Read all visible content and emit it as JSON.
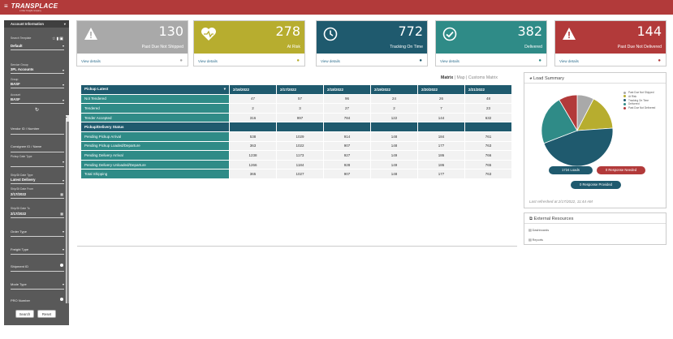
{
  "header": {
    "logo": "TRANSPLACE",
    "logo_sub": "a Uber Freight company",
    "menu_icon": "hamburger-icon"
  },
  "sidebar": {
    "title": "Account Information",
    "search_template_label": "Search Template",
    "search_template_value": "Default",
    "service_group_label": "Service Group",
    "service_group_value": "3PL Accounts",
    "group_label": "Group",
    "group_value": "BASF",
    "account_label": "Account",
    "account_value": "BASF",
    "fields": {
      "vendor_id": "Vendor ID / Number",
      "consignee_id": "Consignee ID / Name",
      "pickup_date_type_label": "Pickup Date Type",
      "ship_date_type_label": "Ship/Dt Date Type",
      "ship_date_type_value": "Latest Delivery",
      "ship_date_from_label": "Ship/Dt Date From",
      "ship_date_from_value": "2/17/2022",
      "ship_date_to_label": "Ship/Dt Date To",
      "ship_date_to_value": "2/17/2022",
      "order_type": "Order Type",
      "freight_type": "Freight Type",
      "shipment_id": "Shipment ID",
      "mode_type": "Mode Type",
      "pro_number": "PRO Number"
    },
    "search_button": "Search",
    "reset_button": "Reset"
  },
  "cards": [
    {
      "value": "130",
      "label": "Past Due Not Shipped",
      "color": "#a9a9a9",
      "link": "View details",
      "icon": "warning-icon",
      "glyph": "▲"
    },
    {
      "value": "278",
      "label": "At Risk",
      "color": "#b7ad2f",
      "link": "View details",
      "icon": "heart-pulse-icon",
      "glyph": "♥"
    },
    {
      "value": "772",
      "label": "Tracking On Time",
      "color": "#1f5a6e",
      "link": "View details",
      "icon": "clock-icon",
      "glyph": "◷"
    },
    {
      "value": "382",
      "label": "Delivered",
      "color": "#2f8b87",
      "link": "View details",
      "icon": "check-circle-icon",
      "glyph": "✓"
    },
    {
      "value": "144",
      "label": "Past Due Not Delivered",
      "color": "#b23a3a",
      "link": "View details",
      "icon": "warning-icon",
      "glyph": "▲"
    }
  ],
  "view_links": {
    "matrix": "Matrix",
    "map": "Map",
    "customs": "Customs Matrix",
    "sep": "|"
  },
  "matrix": {
    "corner": "Pickup Latest",
    "dates": [
      "2/16/2022",
      "2/17/2022",
      "2/18/2022",
      "2/19/2022",
      "2/20/2022",
      "2/21/2022"
    ],
    "rows": [
      {
        "label": "Not Tendered",
        "values": [
          "47",
          "57",
          "96",
          "24",
          "26",
          "48"
        ]
      },
      {
        "label": "Tendered",
        "values": [
          "2",
          "3",
          "27",
          "2",
          "7",
          "23"
        ]
      },
      {
        "label": "Tender Accepted",
        "values": [
          "316",
          "997",
          "784",
          "122",
          "144",
          "632"
        ]
      },
      {
        "label": "Pickup/Delivery Status",
        "section": true,
        "values": [
          "",
          "",
          "",
          "",
          "",
          ""
        ]
      },
      {
        "label": "Pending Pickup Arrival",
        "values": [
          "538",
          "1029",
          "914",
          "148",
          "184",
          "761"
        ]
      },
      {
        "label": "Pending Pickup Loaded/Departure",
        "values": [
          "363",
          "1022",
          "907",
          "148",
          "177",
          "763"
        ]
      },
      {
        "label": "Pending Delivery Arrival",
        "values": [
          "1238",
          "1173",
          "927",
          "149",
          "186",
          "766"
        ]
      },
      {
        "label": "Pending Delivery Unloaded/Departure",
        "values": [
          "1266",
          "1184",
          "928",
          "149",
          "186",
          "765"
        ]
      },
      {
        "label": "Total Shipping",
        "values": [
          "365",
          "1027",
          "907",
          "148",
          "177",
          "763"
        ]
      }
    ]
  },
  "load_summary": {
    "title": "Load Summary",
    "legend": [
      {
        "name": "Past Due Not Shipped",
        "color": "#a9a9a9"
      },
      {
        "name": "At Risk",
        "color": "#b7ad2f"
      },
      {
        "name": "Tracking On Time",
        "color": "#1f5a6e"
      },
      {
        "name": "Delivered",
        "color": "#2f8b87"
      },
      {
        "name": "Past Due Not Delivered",
        "color": "#b23a3a"
      }
    ],
    "pie_values": [
      130,
      278,
      772,
      382,
      144
    ],
    "loads_pill": "1724 Loads",
    "response_needed_pill": "0 Response Needed",
    "response_provided_pill": "0 Response Provided",
    "refreshed": "Last refreshed at 2/17/2022, 11:44 AM"
  },
  "external_resources": {
    "title": "External Resources",
    "items": [
      "Dashboards",
      "Reports"
    ]
  }
}
